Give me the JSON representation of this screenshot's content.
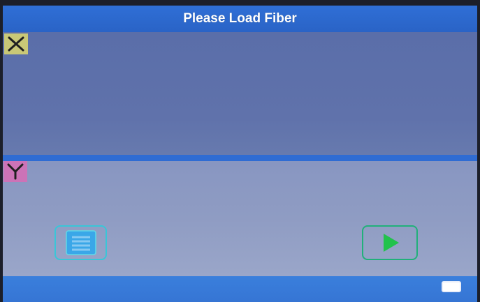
{
  "header": {
    "title": "Please Load Fiber"
  },
  "panes": {
    "x": {
      "label": "X",
      "badge_color": "#c9c877"
    },
    "y": {
      "label": "Y",
      "badge_color": "#cc73b7"
    }
  },
  "buttons": {
    "menu": {
      "icon": "menu-icon",
      "color": "#39c6d8"
    },
    "start": {
      "icon": "play-icon",
      "color": "#21b07a"
    }
  },
  "status": {
    "icon": "battery-icon"
  },
  "colors": {
    "title_bar": "#2f6fd6",
    "pane_x": "#5f73ad",
    "pane_y": "#8f9cc3",
    "status_bar": "#3675d4"
  }
}
